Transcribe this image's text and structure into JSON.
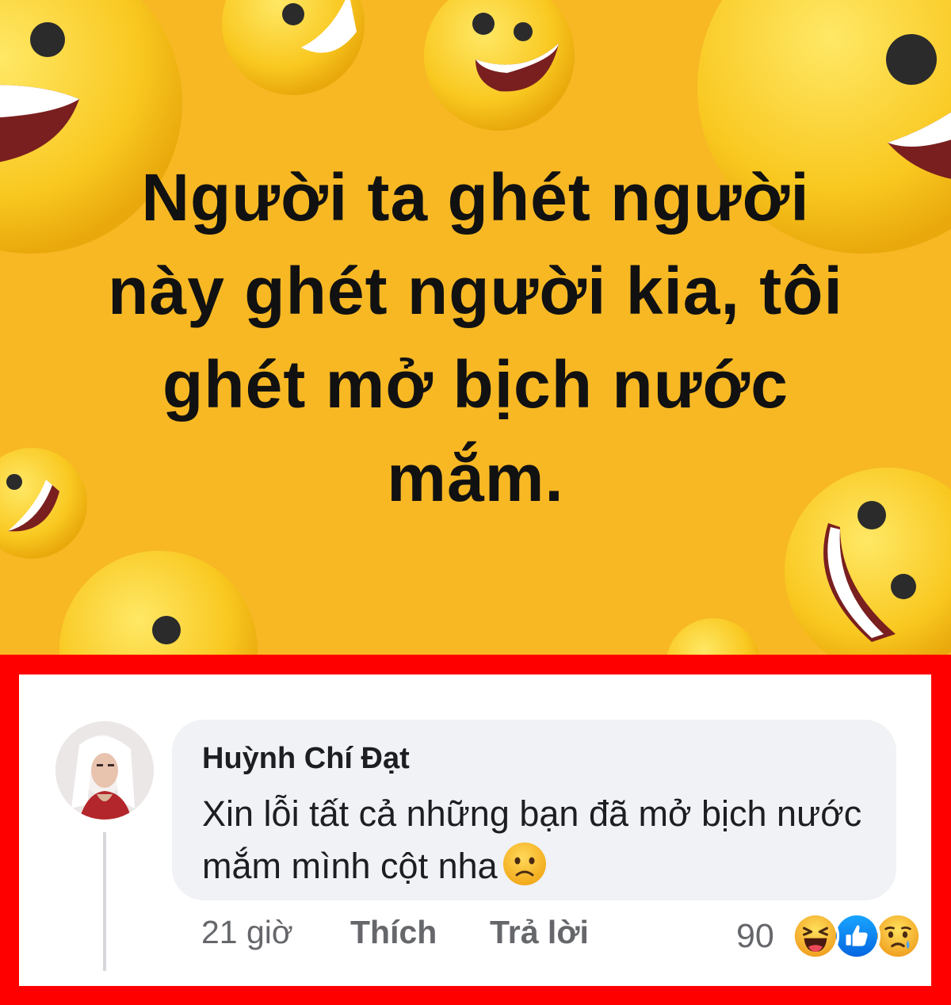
{
  "post": {
    "lines": [
      "Người ta ghét người",
      "này ghét người kia, tôi",
      "ghét mở bịch nước",
      "mắm."
    ],
    "background_color": "#f7b824"
  },
  "comment": {
    "author": "Huỳnh Chí Đạt",
    "text": "Xin lỗi tất cả những bạn đã mở bịch nước mắm mình cột nha",
    "inline_emoji": "frowning-face-icon",
    "time": "21 giờ",
    "like_label": "Thích",
    "reply_label": "Trả lời",
    "reaction_count": "90",
    "reactions": [
      "haha-icon",
      "like-icon",
      "sad-icon"
    ]
  },
  "highlight_color": "#ff0000"
}
